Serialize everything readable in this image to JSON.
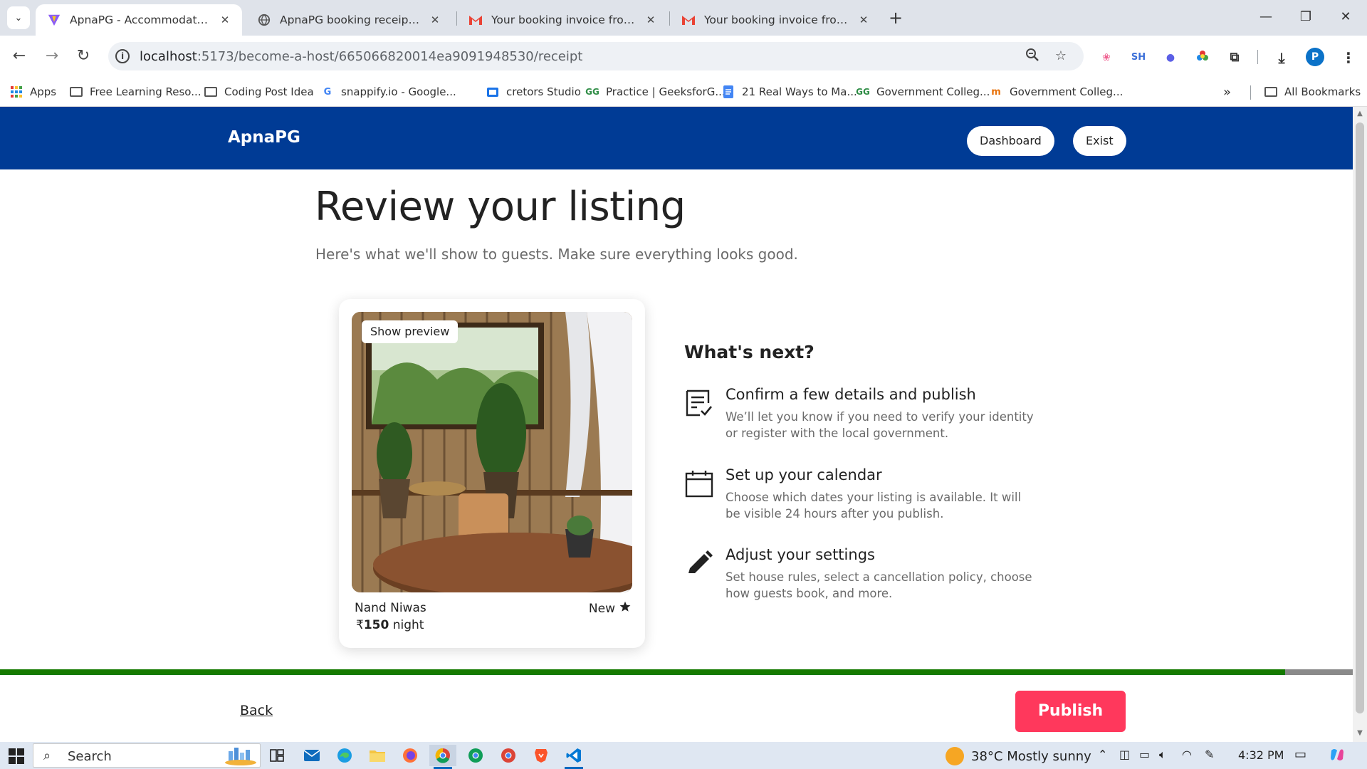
{
  "browser": {
    "tabs": [
      {
        "title": "ApnaPG - Accommodation Solu",
        "active": true,
        "favicon": "vite-icon"
      },
      {
        "title": "ApnaPG booking receipt.pdf",
        "active": false,
        "favicon": "globe-icon"
      },
      {
        "title": "Your booking invoice from Apn",
        "active": false,
        "favicon": "gmail-icon"
      },
      {
        "title": "Your booking invoice from Apn",
        "active": false,
        "favicon": "gmail-icon"
      }
    ],
    "url_host": "localhost",
    "url_path": ":5173/become-a-host/665066820014ea9091948530/receipt",
    "profile_initial": "P",
    "bookmarks": [
      {
        "label": "Apps",
        "icon": "apps-grid-icon"
      },
      {
        "label": "Free Learning Reso...",
        "icon": "folder-icon"
      },
      {
        "label": "Coding Post Idea",
        "icon": "folder-icon"
      },
      {
        "label": "snappify.io - Google...",
        "icon": "google-icon"
      },
      {
        "label": "cretors Studio",
        "icon": "studio-icon"
      },
      {
        "label": "Practice | GeeksforG...",
        "icon": "geeksforgeeks-icon"
      },
      {
        "label": "21 Real Ways to Ma...",
        "icon": "docs-icon"
      },
      {
        "label": "Government Colleg...",
        "icon": "geeksforgeeks-icon"
      },
      {
        "label": "Government Colleg...",
        "icon": "college-icon"
      }
    ],
    "all_bookmarks": "All Bookmarks",
    "ext_sh": "SH"
  },
  "app": {
    "logo": "ApnaPG",
    "dashboard_label": "Dashboard",
    "exist_label": "Exist",
    "colors": {
      "header": "#003b95",
      "publish": "#ff385c",
      "progress": "#157a00"
    }
  },
  "review": {
    "title": "Review your listing",
    "subtitle": "Here's what we'll show to guests. Make sure everything looks good."
  },
  "listing": {
    "show_preview": "Show preview",
    "name": "Nand Niwas",
    "badge": "New",
    "currency": "₹",
    "price": "150",
    "price_unit": "night"
  },
  "next": {
    "title": "What's next?",
    "steps": [
      {
        "icon": "checklist-icon",
        "title": "Confirm a few details and publish",
        "desc": "We’ll let you know if you need to verify your identity or register with the local government."
      },
      {
        "icon": "calendar-icon",
        "title": "Set up your calendar",
        "desc": "Choose which dates your listing is available. It will be visible 24 hours after you publish."
      },
      {
        "icon": "pencil-icon",
        "title": "Adjust your settings",
        "desc": "Set house rules, select a cancellation policy, choose how guests book, and more."
      }
    ]
  },
  "progress": {
    "fraction": 0.95
  },
  "footer": {
    "back_label": "Back",
    "publish_label": "Publish"
  },
  "taskbar": {
    "search_placeholder": "Search",
    "weather": "38°C  Mostly sunny",
    "time": "4:32 PM"
  }
}
